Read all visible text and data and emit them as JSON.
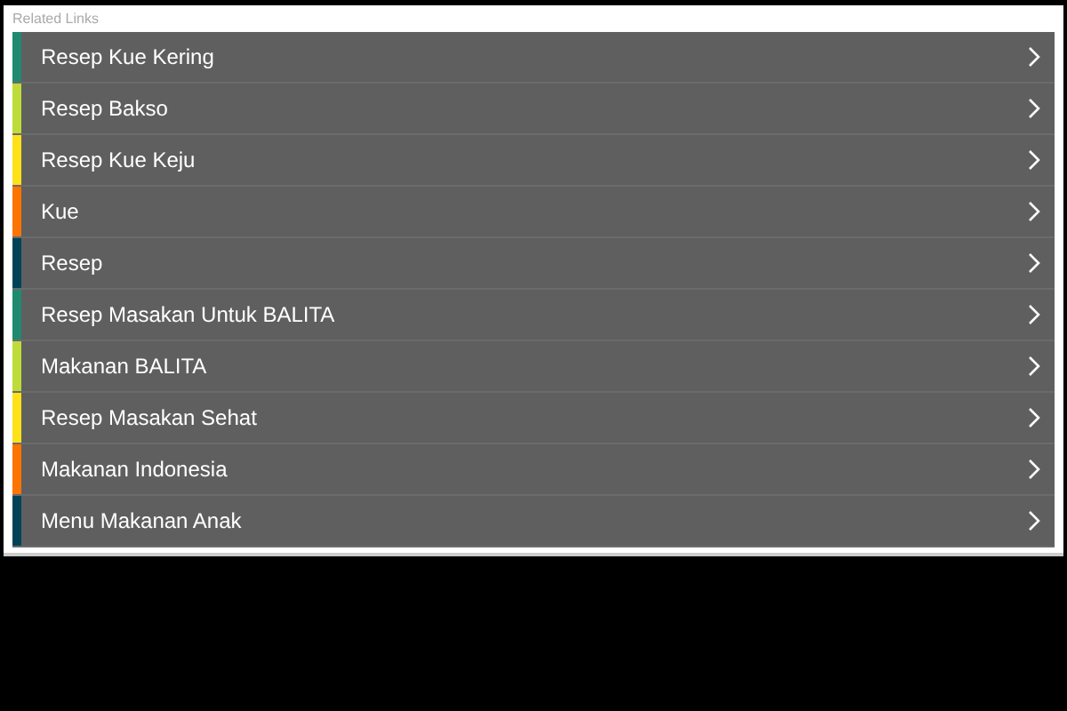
{
  "section": {
    "title": "Related Links"
  },
  "links": [
    {
      "label": "Resep Kue Kering",
      "color": "#1f8a70"
    },
    {
      "label": "Resep Bakso",
      "color": "#bedb39"
    },
    {
      "label": "Resep Kue Keju",
      "color": "#ffe11a"
    },
    {
      "label": "Kue",
      "color": "#fd7400"
    },
    {
      "label": "Resep",
      "color": "#004358"
    },
    {
      "label": "Resep Masakan Untuk BALITA",
      "color": "#1f8a70"
    },
    {
      "label": "Makanan BALITA",
      "color": "#bedb39"
    },
    {
      "label": "Resep Masakan Sehat",
      "color": "#ffe11a"
    },
    {
      "label": "Makanan Indonesia",
      "color": "#fd7400"
    },
    {
      "label": "Menu Makanan Anak",
      "color": "#004358"
    }
  ]
}
